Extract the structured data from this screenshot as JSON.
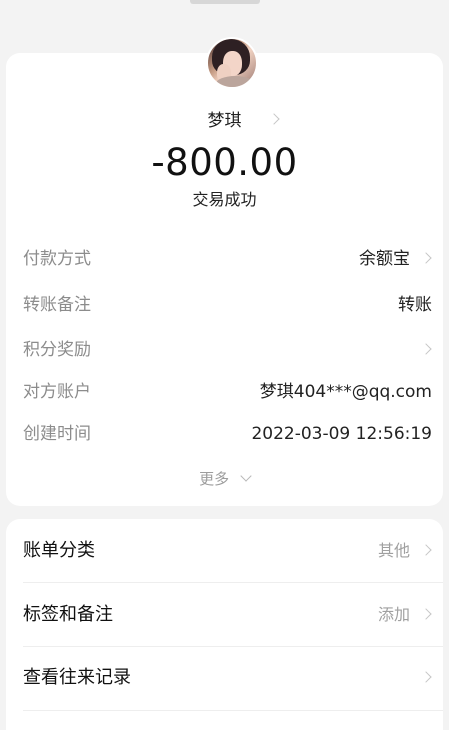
{
  "transaction": {
    "payee_name": "梦琪",
    "amount": "-800.00",
    "status": "交易成功"
  },
  "details": {
    "rows": [
      {
        "label": "付款方式",
        "value": "余额宝"
      },
      {
        "label": "转账备注",
        "value": "转账"
      },
      {
        "label": "积分奖励",
        "value": ""
      },
      {
        "label": "对方账户",
        "value": "梦琪404***@qq.com"
      },
      {
        "label": "创建时间",
        "value": "2022-03-09 12:56:19"
      }
    ],
    "more_label": "更多"
  },
  "actions": {
    "rows": [
      {
        "label": "账单分类",
        "value": "其他"
      },
      {
        "label": "标签和备注",
        "value": "添加"
      },
      {
        "label": "查看往来记录",
        "value": ""
      }
    ]
  },
  "icons": {
    "avatar": "profile-photo",
    "row_arrow": "chevron-right-icon",
    "expand_arrow": "chevron-down-icon"
  },
  "colors": {
    "background": "#f3f3f3",
    "card": "#ffffff",
    "label": "#8c8c8c",
    "text": "#111111"
  }
}
